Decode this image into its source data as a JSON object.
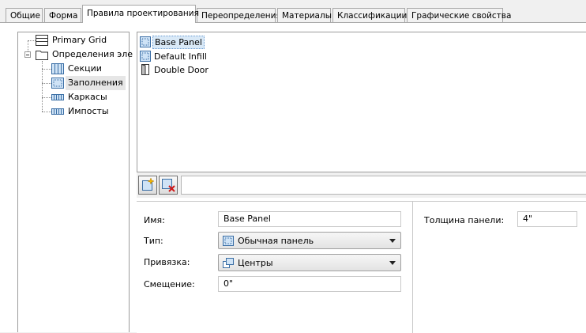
{
  "tabs": [
    {
      "label": "Общие"
    },
    {
      "label": "Форма"
    },
    {
      "label": "Правила проектирования"
    },
    {
      "label": "Переопределения"
    },
    {
      "label": "Материалы"
    },
    {
      "label": "Классификации"
    },
    {
      "label": "Графические свойства"
    }
  ],
  "active_tab": "Правила проектирования",
  "tree": {
    "primary_grid": "Primary Grid",
    "definitions": "Определения эле",
    "children": [
      "Секции",
      "Заполнения",
      "Каркасы",
      "Импосты"
    ],
    "selected": "Заполнения"
  },
  "list": {
    "items": [
      "Base Panel",
      "Default Infill",
      "Double Door"
    ],
    "selected": "Base Panel",
    "icons": [
      "panel-icon",
      "panel-icon",
      "door-icon"
    ]
  },
  "toolbar": {
    "add_icon": "new-item-icon",
    "delete_icon": "delete-item-icon",
    "filter_value": ""
  },
  "properties": {
    "name_label": "Имя:",
    "name_value": "Base Panel",
    "type_label": "Тип:",
    "type_value": "Обычная панель",
    "anchor_label": "Привязка:",
    "anchor_value": "Центры",
    "offset_label": "Смещение:",
    "offset_value": "0\"",
    "thickness_label": "Толщина панели:",
    "thickness_value": "4\""
  }
}
